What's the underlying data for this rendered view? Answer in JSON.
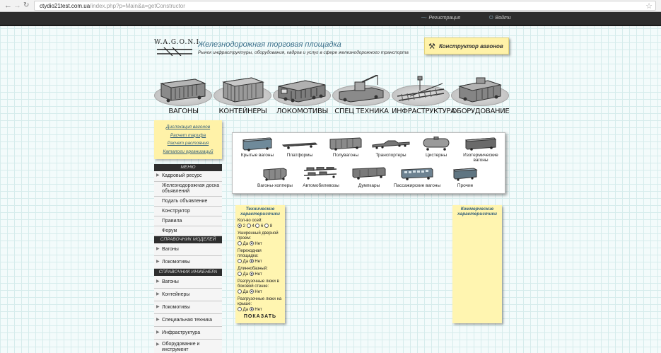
{
  "browser": {
    "host": "ctydio21test.com.ua",
    "path": "/index.php?p=Main&a=getConstructor"
  },
  "topbar": {
    "register": "Регистрация",
    "login": "Войти"
  },
  "header": {
    "logo": "W.A.G.O.N.I",
    "title": "Железнодорожная торговая площадка",
    "subtitle": "Рынок инфраструктуры, оборудования, кадров и услуг в сфере железнодорожного транспорта",
    "constructor_button": "Конструктор вагонов"
  },
  "categories": [
    "ВАГОНЫ",
    "КОНТЕЙНЕРЫ",
    "ЛОКОМОТИВЫ",
    "СПЕЦ ТЕХНИКА",
    "ИНФРАСТРУКТУРА",
    "ОБОРУДОВАНИЕ"
  ],
  "quick_links": [
    "Дислокация вагонов",
    "Расчет тарифа",
    "Расчет растояния",
    "Каталоги организаций"
  ],
  "menu": {
    "head": "МЕНЮ",
    "items": [
      "Кадровый ресурс",
      "Железнодорожная доска объявлений",
      "Подать объявление",
      "Конструктор",
      "Правила",
      "Форум"
    ]
  },
  "models": {
    "head": "СПРАВОЧНИК МОДЕЛЕЙ",
    "items": [
      "Вагоны",
      "Локомотивы"
    ]
  },
  "engineer": {
    "head": "СПРАВОЧНИК ИНЖЕНЕРА",
    "items": [
      "Вагоны",
      "Контейнеры",
      "Локомотивы",
      "Специальная техника",
      "Инфраструктура",
      "Оборудование и инструмент"
    ]
  },
  "wagon_types": [
    "Крытые вагоны",
    "Платформы",
    "Полувагоны",
    "Транспортеры",
    "Цистерны",
    "Изотермические вагоны",
    "Вагоны-хопперы",
    "Автомобилевозы",
    "Думпкары",
    "Пассажирские вагоны",
    "Прочие"
  ],
  "tech": {
    "title": "Технические характеристики",
    "axles_label": "Кол-во осей:",
    "axles": [
      "2",
      "4",
      "6",
      "8"
    ],
    "axles_selected": "2",
    "questions": [
      {
        "label": "Уширенный дверной проем:",
        "yes": "Да",
        "no": "Нет",
        "selected": "no"
      },
      {
        "label": "Переходная площадка:",
        "yes": "Да",
        "no": "Нет",
        "selected": "no"
      },
      {
        "label": "Длиннобазный:",
        "yes": "Да",
        "no": "Нет",
        "selected": "no"
      },
      {
        "label": "Разгрузочные люки в боковой стенке:",
        "yes": "Да",
        "no": "Нет",
        "selected": "no"
      },
      {
        "label": "Разгрузочные люки на крыше:",
        "yes": "Да",
        "no": "Нет",
        "selected": "no"
      }
    ],
    "show_button": "ПОКАЗАТЬ"
  },
  "commercial": {
    "title": "Коммерческие характеристики"
  }
}
